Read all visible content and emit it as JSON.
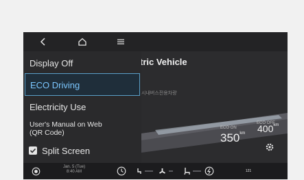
{
  "topbar": {
    "icons": [
      "back-icon",
      "home-icon",
      "menu-icon"
    ]
  },
  "menu": {
    "items": [
      {
        "label": "Display Off"
      },
      {
        "label": "ECO Driving",
        "selected": true
      },
      {
        "label": "Electricity Use"
      },
      {
        "label_line1": "User's Manual on Web",
        "label_line2": "(QR Code)"
      },
      {
        "label": "Split Screen",
        "checked": true
      }
    ]
  },
  "main": {
    "title": "tric Vehicle",
    "subtitle": "시내버스전용차량",
    "range_high_label": "ECO OFF",
    "range_high": "400",
    "range_high_unit": "km",
    "range_low_label": "ECO ON",
    "range_low": "350",
    "range_low_unit": "km"
  },
  "bottombar": {
    "date_line1": "Jan. 5 (Tue)",
    "date_line2": "8:40 AM",
    "media_label": "121"
  },
  "colors": {
    "accent": "#5a9fc8",
    "selected_text": "#7cc7ff",
    "background": "#2c2c2e"
  }
}
